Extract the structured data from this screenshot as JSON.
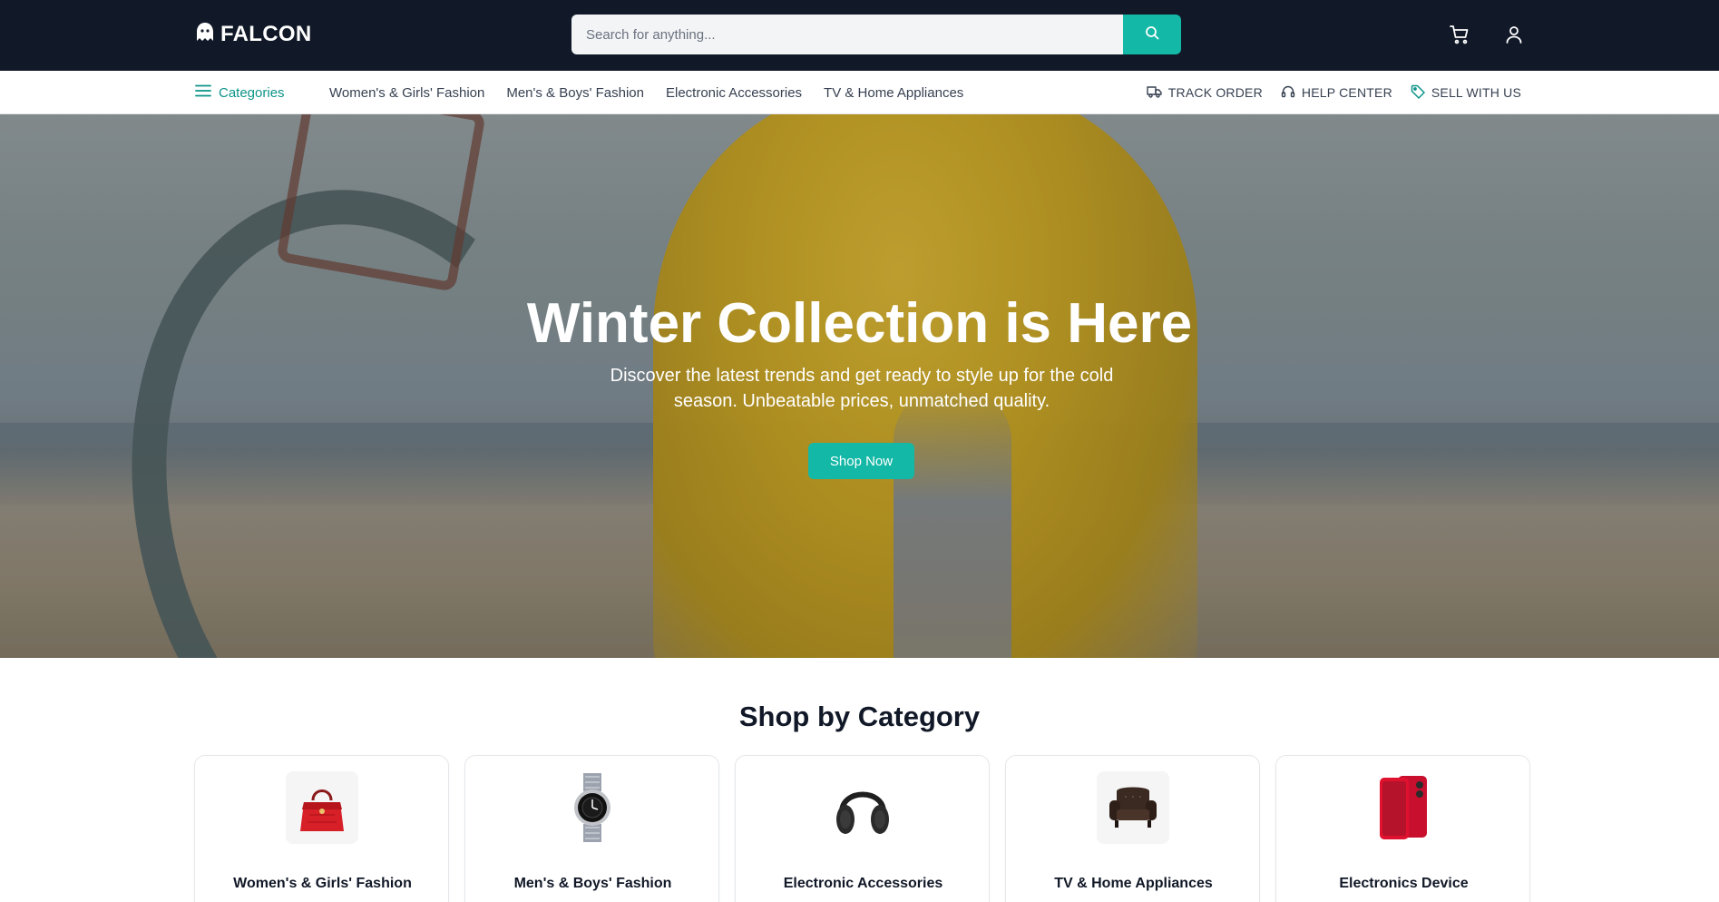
{
  "header": {
    "logo_text": "FALCON",
    "search_placeholder": "Search for anything...",
    "accent_color": "#14b8a6",
    "bg_color": "#111827"
  },
  "nav": {
    "categories_label": "Categories",
    "links": [
      "Women's & Girls' Fashion",
      "Men's & Boys' Fashion",
      "Electronic Accessories",
      "TV & Home Appliances"
    ],
    "right": [
      {
        "label": "TRACK ORDER",
        "icon": "truck-icon"
      },
      {
        "label": "HELP CENTER",
        "icon": "headset-icon"
      },
      {
        "label": "SELL WITH US",
        "icon": "tag-icon"
      }
    ]
  },
  "hero": {
    "title": "Winter Collection is Here",
    "subtitle": "Discover the latest trends and get ready to style up for the cold season. Unbeatable prices, unmatched quality.",
    "cta": "Shop Now"
  },
  "category_section": {
    "title": "Shop by Category",
    "items": [
      {
        "label": "Women's & Girls' Fashion",
        "icon": "handbag-icon"
      },
      {
        "label": "Men's & Boys' Fashion",
        "icon": "watch-icon"
      },
      {
        "label": "Electronic Accessories",
        "icon": "headphones-icon"
      },
      {
        "label": "TV & Home Appliances",
        "icon": "armchair-icon"
      },
      {
        "label": "Electronics Device",
        "icon": "smartphone-icon"
      }
    ]
  }
}
